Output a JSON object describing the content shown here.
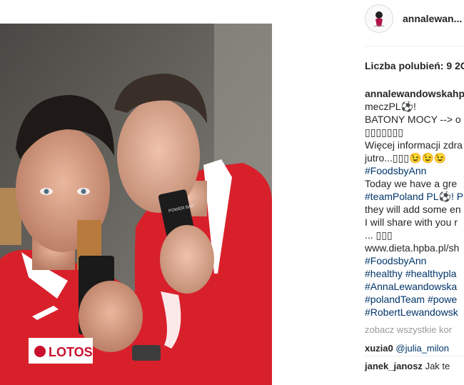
{
  "post": {
    "username": "annalewan...",
    "likes": "Liczba polubień: 9 2C",
    "caption_lines": [
      "annalewandowskahp",
      "meczPL⚽!",
      "BATONY MOCY --> o",
      "▯▯▯▯▯▯▯",
      "Więcej informacji zdra",
      "jutro...▯▯▯😉😉😉",
      "#FoodsbyAnn",
      "Today we have a gre",
      "#teamPoland PL⚽! PO",
      "they will add some en",
      "I will share with you r",
      "... ▯▯▯",
      "www.dieta.hpba.pl/sh",
      "#FoodsbyAnn",
      "#healthy #healthypla",
      "#AnnaLewandowska",
      "#polandTeam #powe",
      "#RobertLewandowsk"
    ],
    "view_all": "zobacz wszystkie kor",
    "comments": [
      {
        "user": "xuzia0",
        "text": "@julia_milon"
      },
      {
        "user": "janek_janosz",
        "text": "Jak te"
      }
    ]
  },
  "photo": {
    "shirt_sponsor": "LOTOS",
    "bar_wrapper": "POWER BAR"
  },
  "colors": {
    "text": "#262626",
    "hashtag": "#003569",
    "muted": "#999999",
    "jersey": "#d8202b"
  }
}
